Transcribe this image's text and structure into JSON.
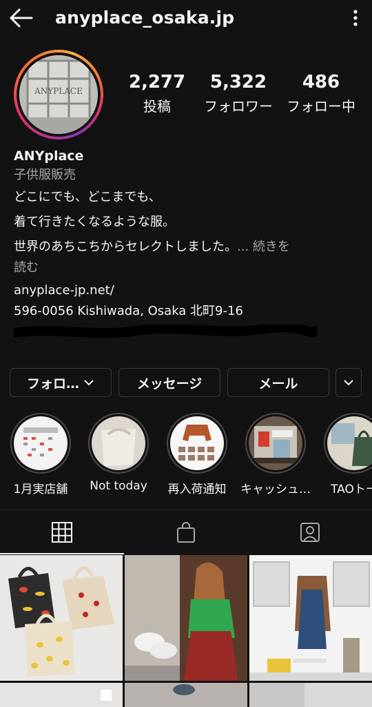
{
  "header": {
    "username": "anyplace_osaka.jp",
    "back_icon": "back-arrow-icon",
    "menu_icon": "more-vertical-icon"
  },
  "stats": {
    "posts": {
      "count": "2,277",
      "label": "投稿"
    },
    "followers": {
      "count": "5,322",
      "label": "フォロワー"
    },
    "following": {
      "count": "486",
      "label": "フォロー中"
    }
  },
  "bio": {
    "name": "ANYplace",
    "category": "子供服販売",
    "lines": [
      "どこにでも、どこまでも、",
      "着て行きたくなるような服。",
      "世界のあちこちからセレクトしました。"
    ],
    "more_label": "... 続きを",
    "more_label_wrap": "読む",
    "website": "anyplace-jp.net/",
    "address": "596-0056 Kishiwada, Osaka 北町9-16"
  },
  "buttons": {
    "follow": "フォロ…",
    "message": "メッセージ",
    "email": "メール"
  },
  "highlights": [
    {
      "label": "1月実店舗"
    },
    {
      "label": "Not today"
    },
    {
      "label": "再入荷通知"
    },
    {
      "label": "キャッシュ…"
    },
    {
      "label": "TAOトー"
    }
  ],
  "tabs": [
    "grid-icon",
    "shop-bag-icon",
    "tagged-person-icon"
  ],
  "colors": {
    "background": "#121212",
    "text": "#f5f5f5",
    "secondary": "#a8a8a8",
    "border": "#3a3a3a"
  }
}
